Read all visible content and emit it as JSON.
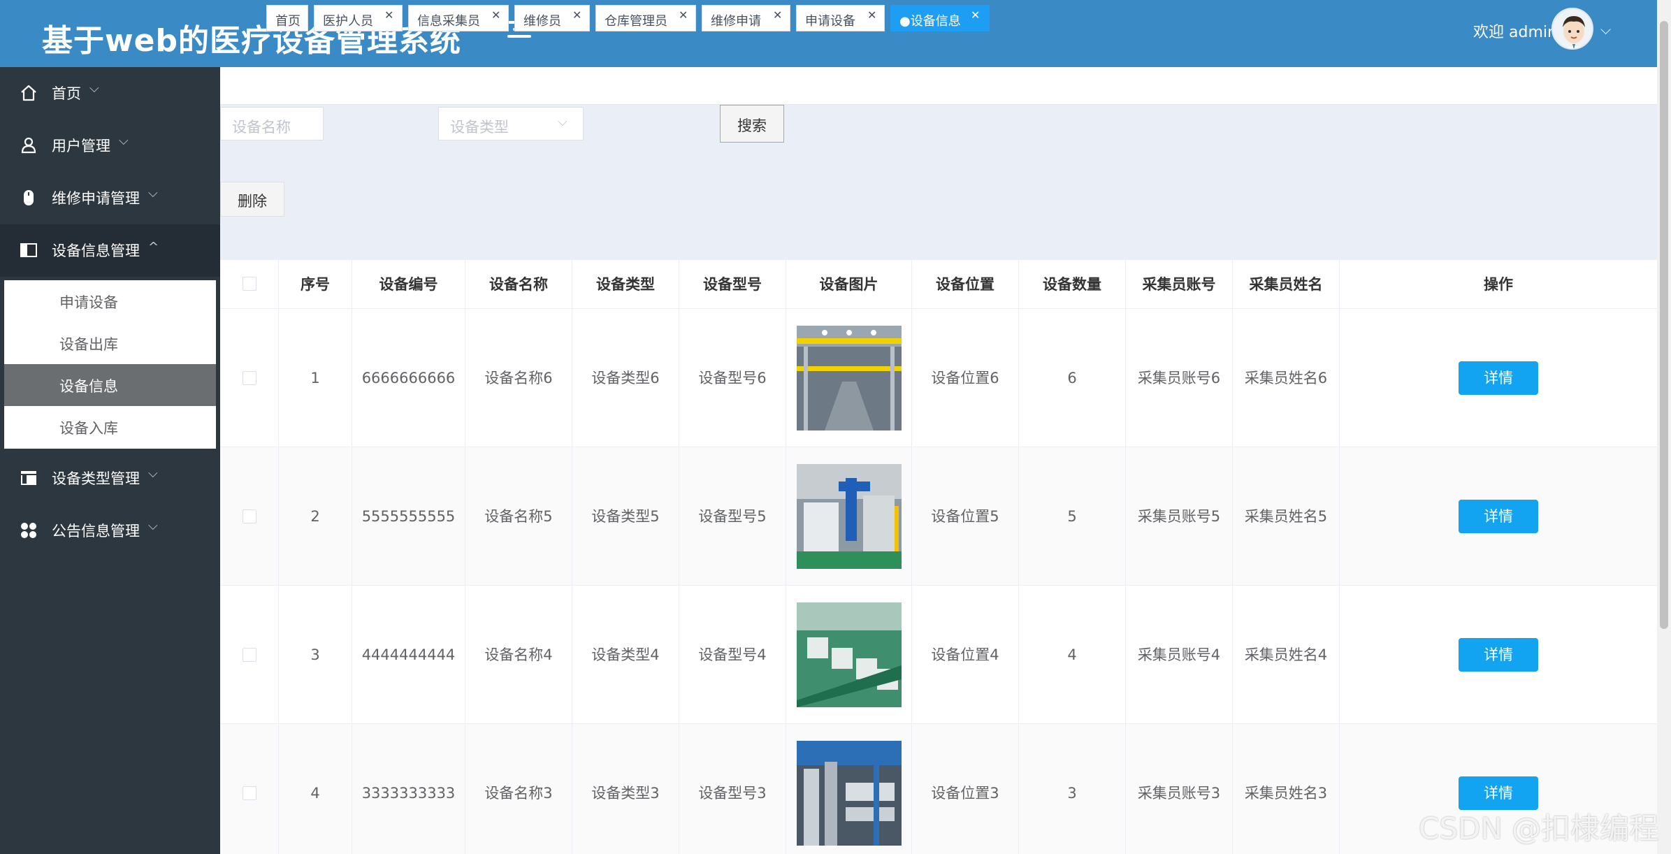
{
  "header": {
    "title": "基于web的医疗设备管理系统",
    "welcome": "欢迎 admin"
  },
  "sidebar": {
    "items": [
      {
        "label": "首页"
      },
      {
        "label": "用户管理"
      },
      {
        "label": "维修申请管理"
      },
      {
        "label": "设备信息管理"
      },
      {
        "label": "设备类型管理"
      },
      {
        "label": "公告信息管理"
      }
    ],
    "submenu": [
      {
        "label": "申请设备"
      },
      {
        "label": "设备出库"
      },
      {
        "label": "设备信息"
      },
      {
        "label": "设备入库"
      }
    ]
  },
  "tags": [
    {
      "label": "首页"
    },
    {
      "label": "医护人员"
    },
    {
      "label": "信息采集员"
    },
    {
      "label": "维修员"
    },
    {
      "label": "仓库管理员"
    },
    {
      "label": "维修申请"
    },
    {
      "label": "申请设备"
    },
    {
      "label": "●设备信息"
    }
  ],
  "search": {
    "name_placeholder": "设备名称",
    "type_placeholder": "设备类型",
    "search_label": "搜索",
    "delete_label": "删除"
  },
  "table": {
    "columns": [
      "序号",
      "设备编号",
      "设备名称",
      "设备类型",
      "设备型号",
      "设备图片",
      "设备位置",
      "设备数量",
      "采集员账号",
      "采集员姓名",
      "操作"
    ],
    "detail_label": "详情",
    "rows": [
      {
        "index": "1",
        "code": "6666666666",
        "name": "设备名称6",
        "type": "设备类型6",
        "model": "设备型号6",
        "location": "设备位置6",
        "qty": "6",
        "acct": "采集员账号6",
        "collector": "采集员姓名6"
      },
      {
        "index": "2",
        "code": "5555555555",
        "name": "设备名称5",
        "type": "设备类型5",
        "model": "设备型号5",
        "location": "设备位置5",
        "qty": "5",
        "acct": "采集员账号5",
        "collector": "采集员姓名5"
      },
      {
        "index": "3",
        "code": "4444444444",
        "name": "设备名称4",
        "type": "设备类型4",
        "model": "设备型号4",
        "location": "设备位置4",
        "qty": "4",
        "acct": "采集员账号4",
        "collector": "采集员姓名4"
      },
      {
        "index": "4",
        "code": "3333333333",
        "name": "设备名称3",
        "type": "设备类型3",
        "model": "设备型号3",
        "location": "设备位置3",
        "qty": "3",
        "acct": "采集员账号3",
        "collector": "采集员姓名3"
      }
    ]
  },
  "watermark": "CSDN @扣棣编程",
  "colors": {
    "header": "#3a8ac6",
    "sidebar": "#2d3740",
    "accent": "#1e9ef3",
    "detail_button": "#12a4f0"
  }
}
